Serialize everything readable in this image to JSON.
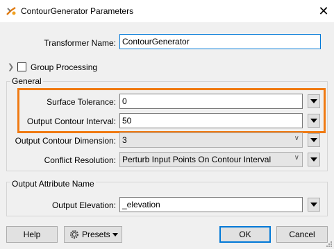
{
  "window": {
    "title": "ContourGenerator Parameters",
    "close_symbol": "✕"
  },
  "transformer_name": {
    "label": "Transformer Name:",
    "value": "ContourGenerator"
  },
  "group_processing": {
    "label": "Group Processing",
    "checked": false
  },
  "general": {
    "title": "General",
    "surface_tolerance": {
      "label": "Surface Tolerance:",
      "value": "0"
    },
    "output_contour_interval": {
      "label": "Output Contour Interval:",
      "value": "50"
    },
    "output_contour_dimension": {
      "label": "Output Contour Dimension:",
      "value": "3"
    },
    "conflict_resolution": {
      "label": "Conflict Resolution:",
      "value": "Perturb Input Points On Contour Interval"
    }
  },
  "output_attribute_name": {
    "title": "Output Attribute Name",
    "output_elevation": {
      "label": "Output Elevation:",
      "value": "_elevation"
    }
  },
  "footer": {
    "help": "Help",
    "presets": "Presets",
    "ok": "OK",
    "cancel": "Cancel"
  },
  "colors": {
    "highlight": "#f07a12",
    "focus": "#0078d7"
  }
}
